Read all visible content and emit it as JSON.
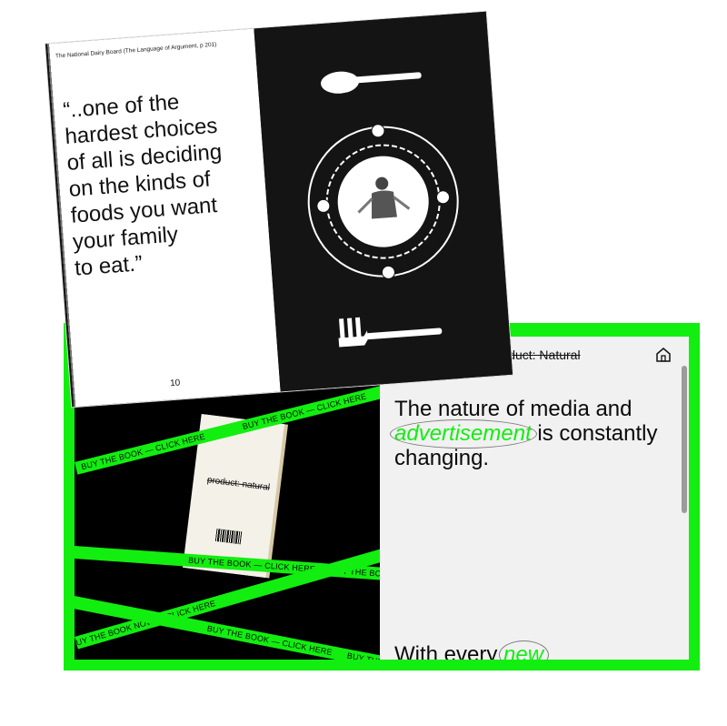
{
  "magazine": {
    "source_line": "The National Dairy Board (The Language of Argument, p 201)",
    "quote_lines": [
      "“..one of the",
      "hardest choices",
      "of all is deciding",
      "on the kinds of",
      "foods you want",
      "your family",
      "to eat.”"
    ],
    "page_number": "10"
  },
  "video": {
    "tape_text": "BUY THE BOOK — CLICK HERE",
    "tape_text_alt": "UY THE BOOK NOW — CLICK HERE",
    "book_title": "product: natural"
  },
  "panel": {
    "title": "Product: Natural",
    "text_before": "The nature of media and",
    "highlight": "advertisement",
    "text_after": " is constantly changing.",
    "bottom_text": "With every ",
    "bottom_highlight": "new",
    "home_icon": "home-icon"
  },
  "colors": {
    "accent": "#12ee10",
    "panel_bg": "#f1f1f1",
    "video_bg": "#000000"
  }
}
